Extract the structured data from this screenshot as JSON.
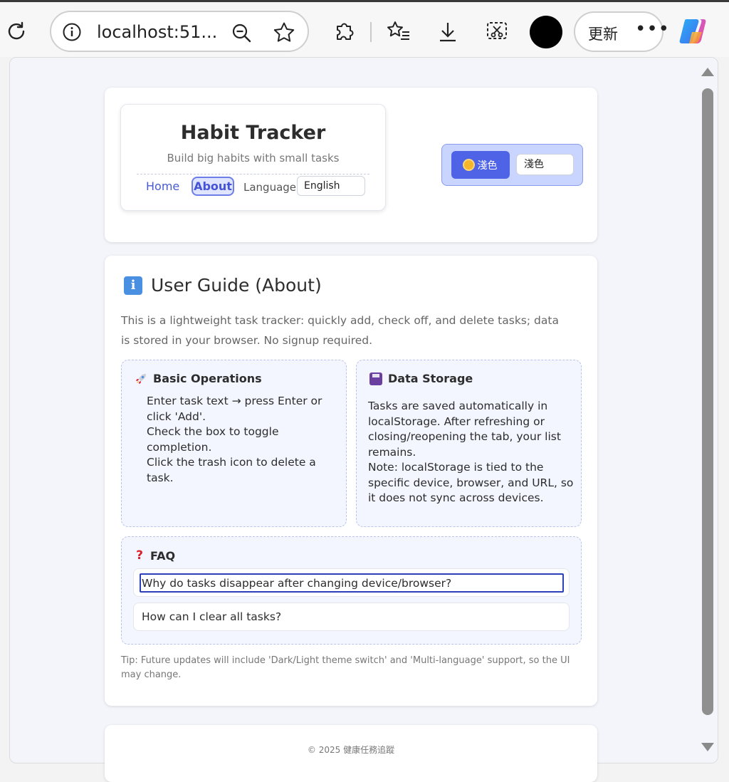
{
  "browser": {
    "address": "localhost:51...",
    "update_label": "更新",
    "more_label": "•••"
  },
  "header": {
    "title": "Habit Tracker",
    "subtitle": "Build big habits with small tasks",
    "nav": {
      "home": "Home",
      "about": "About",
      "language_label": "Language",
      "language_value": "English"
    },
    "theme": {
      "button_label": "淺色",
      "select_value": "淺色"
    }
  },
  "guide": {
    "title": "User Guide (About)",
    "intro": "This is a lightweight task tracker: quickly add, check off, and delete tasks; data is stored in your browser. No signup required.",
    "basic_ops": {
      "heading": "Basic Operations",
      "items": [
        "Enter task text → press Enter or click 'Add'.",
        "Check the box to toggle completion.",
        "Click the trash icon to delete a task."
      ]
    },
    "storage": {
      "heading": "Data Storage",
      "text1": "Tasks are saved automatically in localStorage. After refreshing or closing/reopening the tab, your list remains.",
      "text2": "Note: localStorage is tied to the specific device, browser, and URL, so it does not sync across devices."
    },
    "faq": {
      "heading": "FAQ",
      "items": [
        "Why do tasks disappear after changing device/browser?",
        "How can I clear all tasks?"
      ]
    },
    "tip": "Tip: Future updates will include 'Dark/Light theme switch' and 'Multi-language' support, so the UI may change."
  },
  "footer": {
    "text": "© 2025 健康任務追蹤"
  },
  "colors": {
    "accent": "#4f63e6",
    "nav_link": "#4a5bd0",
    "panel_bg": "#f3f6ff"
  }
}
